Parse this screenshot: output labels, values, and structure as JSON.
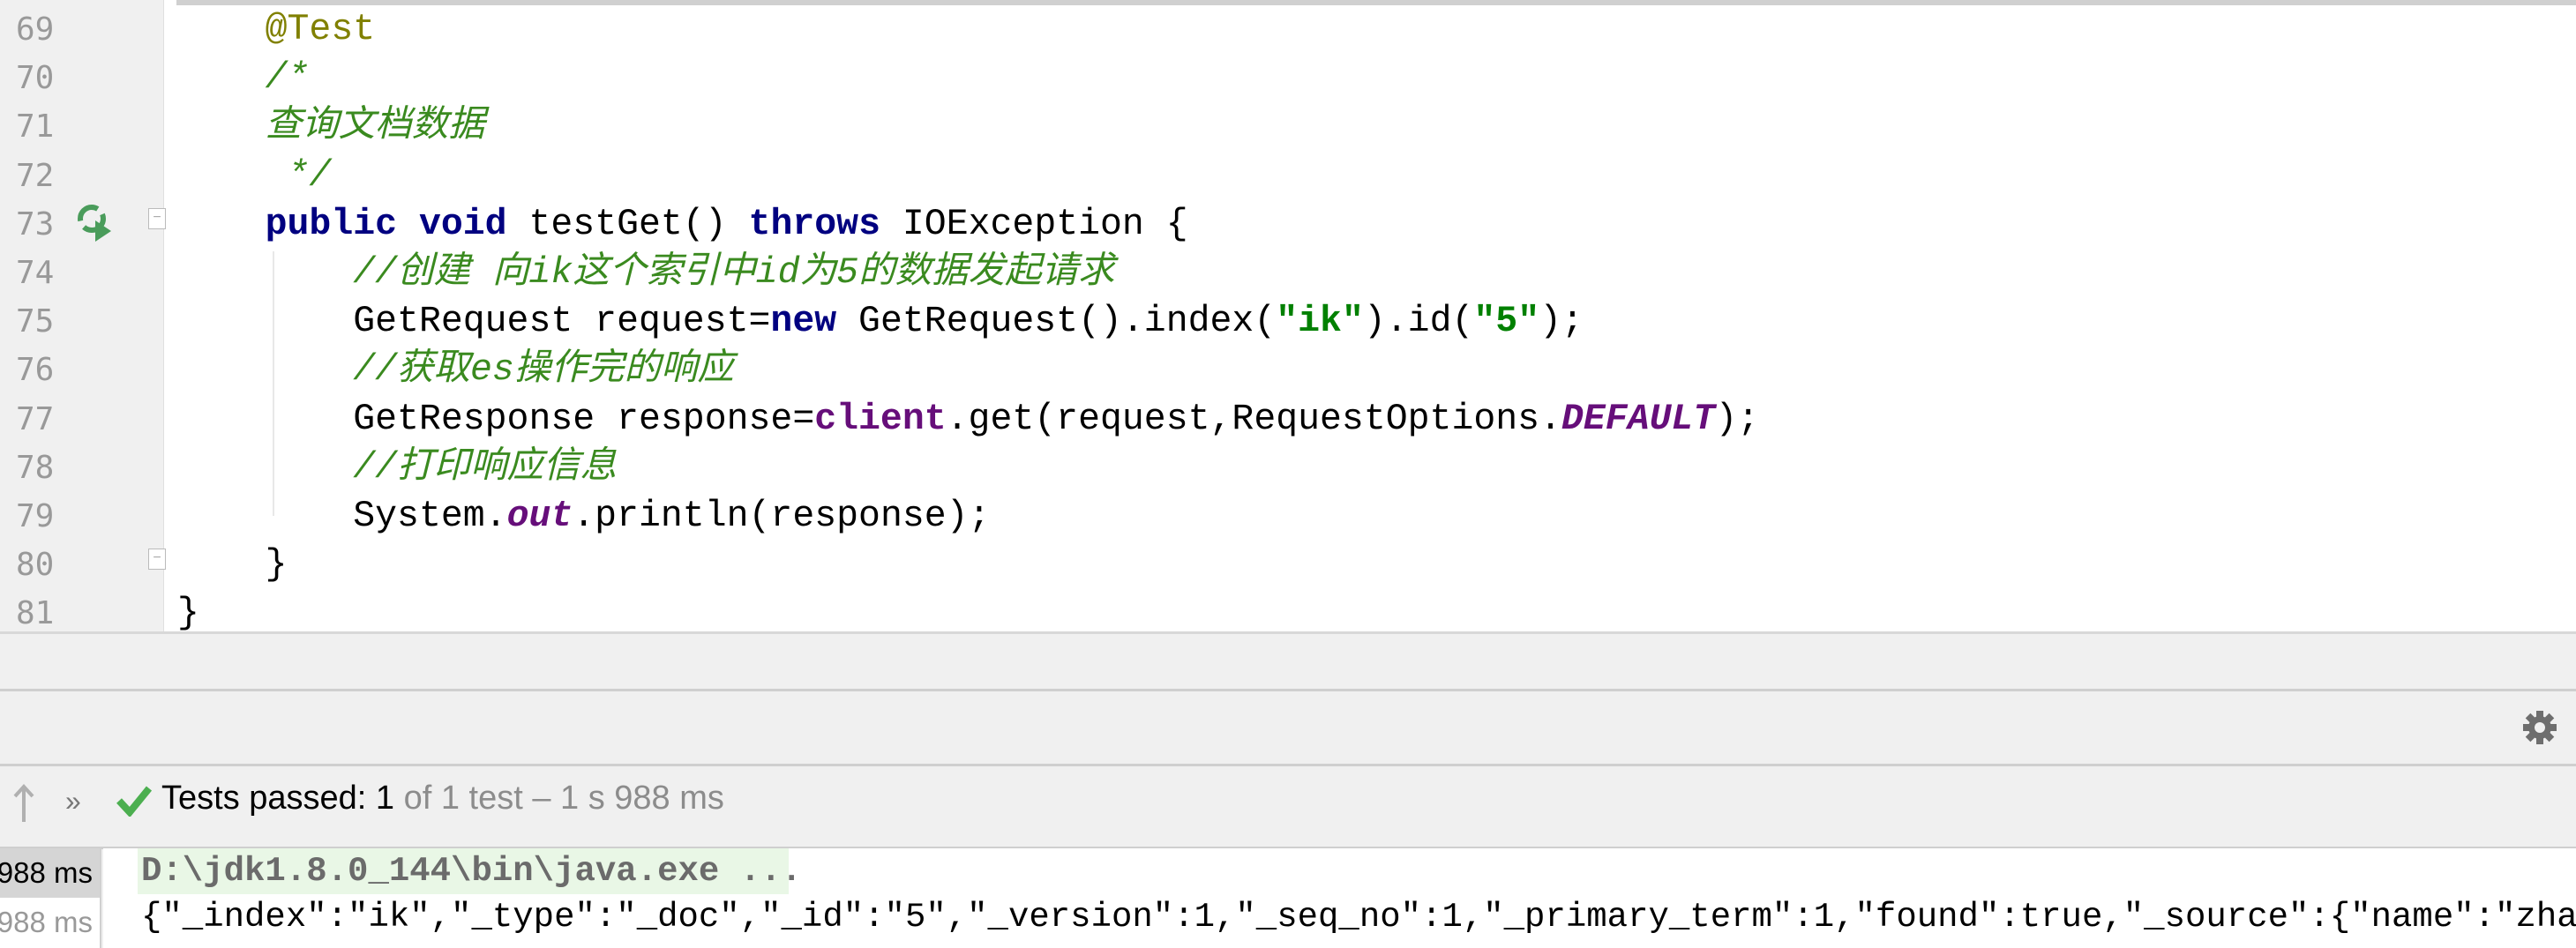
{
  "editor": {
    "lines": [
      {
        "num": "69",
        "parts": [
          {
            "t": "    "
          },
          {
            "t": "@Test",
            "c": "ann"
          }
        ]
      },
      {
        "num": "70",
        "parts": [
          {
            "t": "    "
          },
          {
            "t": "/*",
            "c": "cm"
          }
        ]
      },
      {
        "num": "71",
        "parts": [
          {
            "t": "    "
          },
          {
            "t": "查询文档数据",
            "c": "cm"
          }
        ]
      },
      {
        "num": "72",
        "parts": [
          {
            "t": "     "
          },
          {
            "t": "*/",
            "c": "cm"
          }
        ]
      },
      {
        "num": "73",
        "parts": [
          {
            "t": "    "
          },
          {
            "t": "public",
            "c": "kw"
          },
          {
            "t": " "
          },
          {
            "t": "void",
            "c": "kw"
          },
          {
            "t": " testGet() "
          },
          {
            "t": "throws",
            "c": "kw"
          },
          {
            "t": " IOException {"
          }
        ]
      },
      {
        "num": "74",
        "parts": [
          {
            "t": "        "
          },
          {
            "t": "//创建 向ik这个索引中id为5的数据发起请求",
            "c": "cm"
          }
        ]
      },
      {
        "num": "75",
        "parts": [
          {
            "t": "        GetRequest request="
          },
          {
            "t": "new",
            "c": "kw"
          },
          {
            "t": " GetRequest().index("
          },
          {
            "t": "\"ik\"",
            "c": "str"
          },
          {
            "t": ").id("
          },
          {
            "t": "\"5\"",
            "c": "str"
          },
          {
            "t": ");"
          }
        ]
      },
      {
        "num": "76",
        "parts": [
          {
            "t": "        "
          },
          {
            "t": "//获取es操作完的响应",
            "c": "cm"
          }
        ]
      },
      {
        "num": "77",
        "parts": [
          {
            "t": "        GetResponse response="
          },
          {
            "t": "client",
            "c": "fld"
          },
          {
            "t": ".get(request,RequestOptions."
          },
          {
            "t": "DEFAULT",
            "c": "sfld"
          },
          {
            "t": ");"
          }
        ]
      },
      {
        "num": "78",
        "parts": [
          {
            "t": "        "
          },
          {
            "t": "//打印响应信息",
            "c": "cm"
          }
        ]
      },
      {
        "num": "79",
        "parts": [
          {
            "t": "        System."
          },
          {
            "t": "out",
            "c": "sfld"
          },
          {
            "t": ".println(response);"
          }
        ]
      },
      {
        "num": "80",
        "parts": [
          {
            "t": "    }"
          }
        ]
      },
      {
        "num": "81",
        "parts": [
          {
            "t": "}"
          }
        ]
      }
    ]
  },
  "run_panel": {
    "status_passed": "Tests passed: 1",
    "status_rest": " of 1 test – 1 s 988 ms",
    "durations": [
      "988 ms",
      "988 ms"
    ],
    "console": [
      "D:\\jdk1.8.0_144\\bin\\java.exe ...",
      "{\"_index\":\"ik\",\"_type\":\"_doc\",\"_id\":\"5\",\"_version\":1,\"_seq_no\":1,\"_primary_term\":1,\"found\":true,\"_source\":{\"name\":\"zhang"
    ]
  },
  "colors": {
    "keyword": "#000080",
    "string": "#008000",
    "comment": "#3a8a1f",
    "annotation": "#808000",
    "field": "#660e7a",
    "pass": "#4caf50"
  }
}
